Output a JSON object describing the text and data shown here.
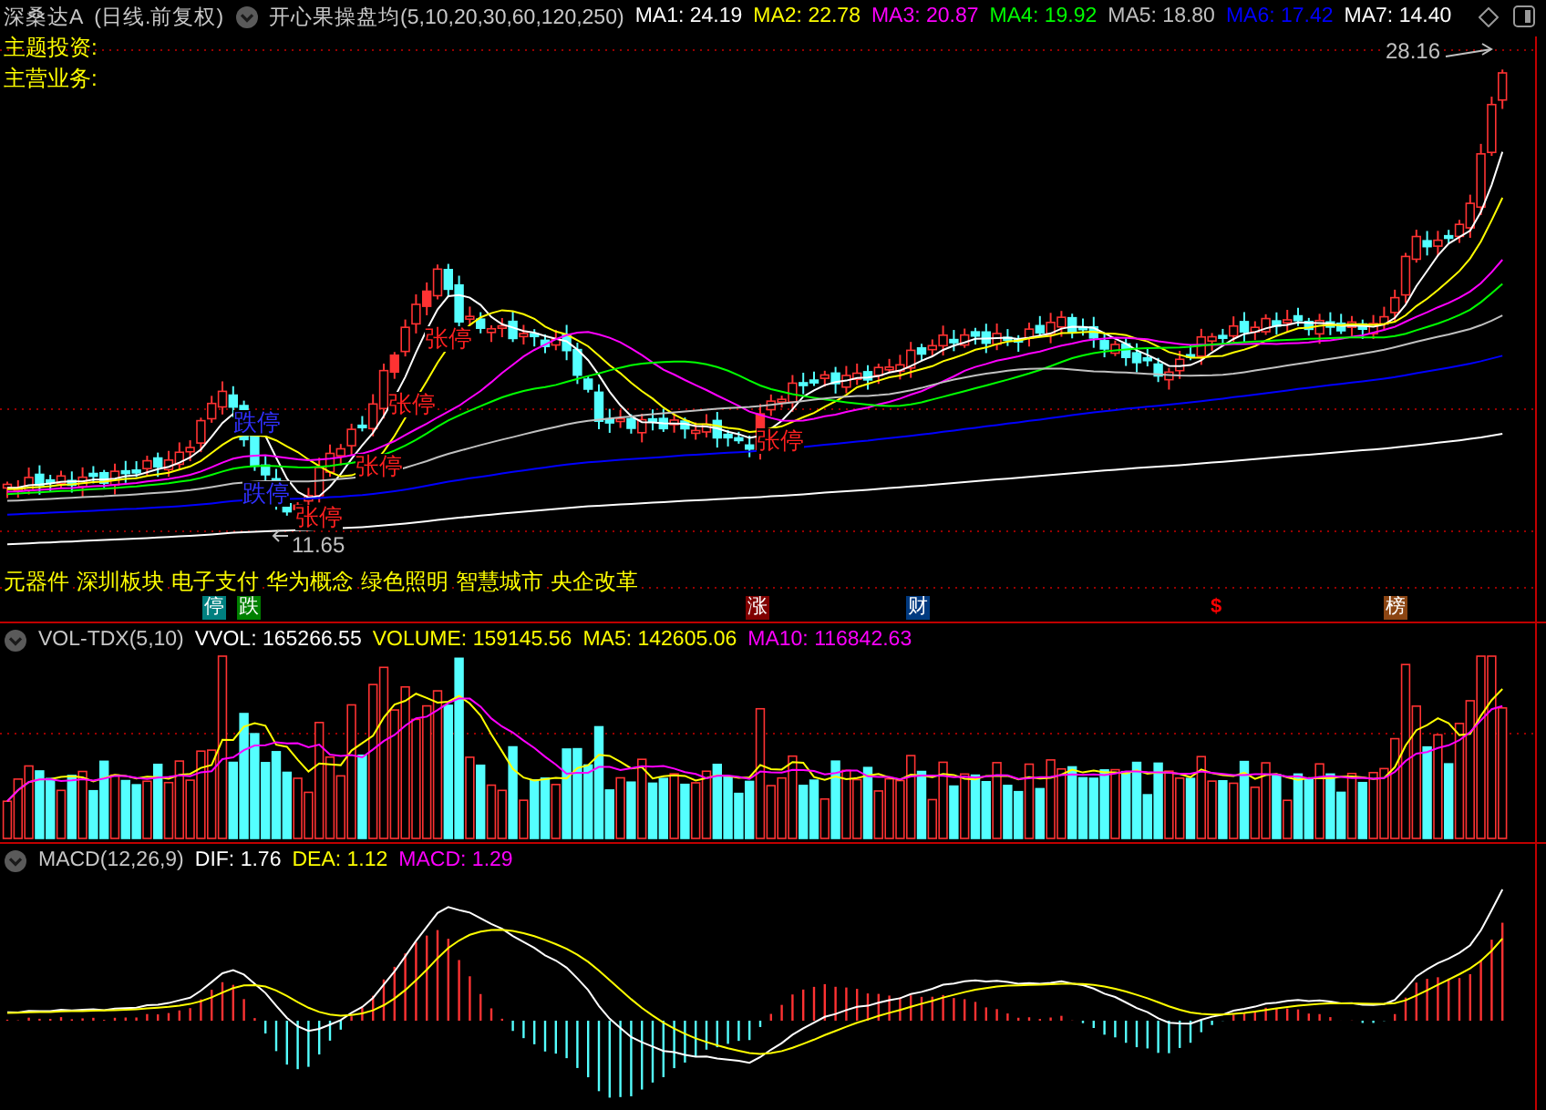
{
  "main_panel": {
    "title": "深桑达A",
    "period": "(日线.前复权)",
    "indicator": "开心果操盘均(5,10,20,30,60,120,250)",
    "ma_readings": [
      {
        "label": "MA1:",
        "value": "24.19",
        "color": "#ffffff"
      },
      {
        "label": "MA2:",
        "value": "22.78",
        "color": "#ffff00"
      },
      {
        "label": "MA3:",
        "value": "20.87",
        "color": "#ff00ff"
      },
      {
        "label": "MA4:",
        "value": "19.92",
        "color": "#00ff00"
      },
      {
        "label": "MA5:",
        "value": "18.80",
        "color": "#c0c0c0"
      },
      {
        "label": "MA6:",
        "value": "17.42",
        "color": "#0000ff"
      },
      {
        "label": "MA7:",
        "value": "14.40",
        "color": "#ffffff"
      }
    ],
    "info_labels": [
      "主题投资:",
      "主营业务:"
    ],
    "high_label": "28.16",
    "low_label": "11.65",
    "annotations": [
      {
        "text": "跌停",
        "kind": "limit_down"
      },
      {
        "text": "跌停",
        "kind": "limit_down"
      },
      {
        "text": "张停",
        "kind": "limit_up"
      },
      {
        "text": "张停",
        "kind": "limit_up"
      },
      {
        "text": "张停",
        "kind": "limit_up"
      },
      {
        "text": "张停",
        "kind": "limit_up"
      },
      {
        "text": "张停",
        "kind": "limit_up"
      }
    ],
    "concepts": [
      "元器件",
      "深圳板块",
      "电子支付",
      "华为概念",
      "绿色照明",
      "智慧城市",
      "央企改革"
    ],
    "event_badges": [
      {
        "text": "停",
        "kind": "tag",
        "color": "#008080"
      },
      {
        "text": "跌",
        "kind": "tag",
        "color": "#008000"
      },
      {
        "text": "涨",
        "kind": "tag",
        "color": "#800000"
      },
      {
        "text": "财",
        "kind": "tag",
        "color": "#003a80"
      },
      {
        "text": "$",
        "kind": "mark",
        "color": "#ff0000"
      },
      {
        "text": "榜",
        "kind": "tag",
        "color": "#8b4513"
      }
    ]
  },
  "volume_panel": {
    "indicator": "VOL-TDX(5,10)",
    "readings": [
      {
        "label": "VVOL:",
        "value": "165266.55",
        "color": "#ffffff"
      },
      {
        "label": "VOLUME:",
        "value": "159145.56",
        "color": "#ffff00"
      },
      {
        "label": "MA5:",
        "value": "142605.06",
        "color": "#ffff00"
      },
      {
        "label": "MA10:",
        "value": "116842.63",
        "color": "#ff00ff"
      }
    ]
  },
  "macd_panel": {
    "indicator": "MACD(12,26,9)",
    "readings": [
      {
        "label": "DIF:",
        "value": "1.76",
        "color": "#ffffff"
      },
      {
        "label": "DEA:",
        "value": "1.12",
        "color": "#ffff00"
      },
      {
        "label": "MACD:",
        "value": "1.29",
        "color": "#ff00ff"
      }
    ]
  }
}
